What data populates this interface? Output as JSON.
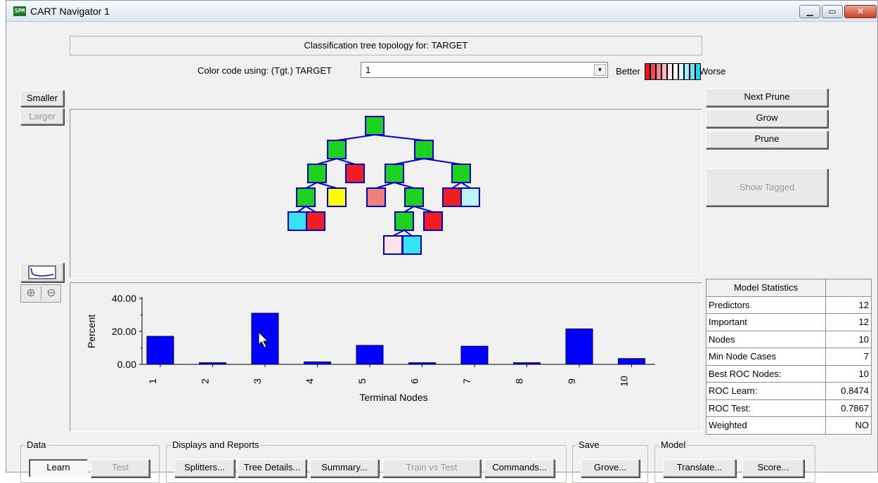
{
  "window": {
    "title": "CART Navigator 1",
    "app_icon_text": "SPM",
    "controls": [
      "minimize",
      "maximize",
      "close"
    ]
  },
  "header": {
    "topology_title": "Classification tree topology for: TARGET",
    "color_code_label": "Color code using: (Tgt.) TARGET",
    "color_code_value": "1",
    "legend_better": "Better",
    "legend_worse": "Worse",
    "legend_colors": [
      "#e8141e",
      "#ee4a54",
      "#f47f88",
      "#f8b8bd",
      "#fde6e8",
      "#ffffff",
      "#d8f6fb",
      "#a6ecf7",
      "#6ee1f4",
      "#27d7f2"
    ]
  },
  "left_buttons": {
    "smaller": "Smaller",
    "larger": "Larger",
    "zoom_in_glyph": "⊕",
    "zoom_out_glyph": "⊖"
  },
  "right_buttons": {
    "next_prune": "Next Prune",
    "grow": "Grow",
    "prune": "Prune",
    "show_tagged": "Show Tagged"
  },
  "tree": {
    "node_colors": {
      "green": "#1fd11f",
      "red": "#ee1e22",
      "yellow": "#ffff00",
      "salmon": "#f08080",
      "cyan": "#36e3f2",
      "light_cyan": "#bdf2fa",
      "pink": "#fde3e8",
      "border": "#0000cc",
      "edge": "#0000dd"
    }
  },
  "chart_data": {
    "type": "bar",
    "categories": [
      "1",
      "2",
      "3",
      "4",
      "5",
      "6",
      "7",
      "8",
      "9",
      "10"
    ],
    "values": [
      17.0,
      1.0,
      31.0,
      1.5,
      11.5,
      1.0,
      11.0,
      1.0,
      21.5,
      3.5
    ],
    "xlabel": "Terminal Nodes",
    "ylabel": "Percent",
    "yticks": [
      "0.00",
      "20.00",
      "40.00"
    ],
    "ylim": [
      0,
      40
    ],
    "bar_color": "#0000ff",
    "grid": false
  },
  "model_statistics": {
    "title": "Model Statistics",
    "rows": [
      {
        "label": "Predictors",
        "value": "12"
      },
      {
        "label": "Important",
        "value": "12"
      },
      {
        "label": "Nodes",
        "value": "10"
      },
      {
        "label": "Min Node Cases",
        "value": "7"
      },
      {
        "label": "Best ROC Nodes:",
        "value": "10"
      },
      {
        "label": "ROC Learn:",
        "value": "0.8474"
      },
      {
        "label": "ROC Test:",
        "value": "0.7867"
      },
      {
        "label": "Weighted",
        "value": "NO"
      }
    ]
  },
  "groups": {
    "data": {
      "title": "Data",
      "learn": "Learn",
      "test": "Test"
    },
    "displays": {
      "title": "Displays and Reports",
      "splitters": "Splitters...",
      "tree_details": "Tree Details...",
      "summary": "Summary...",
      "train_vs_test": "Train vs Test",
      "commands": "Commands..."
    },
    "save": {
      "title": "Save",
      "grove": "Grove..."
    },
    "model": {
      "title": "Model",
      "translate": "Translate...",
      "score": "Score..."
    }
  }
}
